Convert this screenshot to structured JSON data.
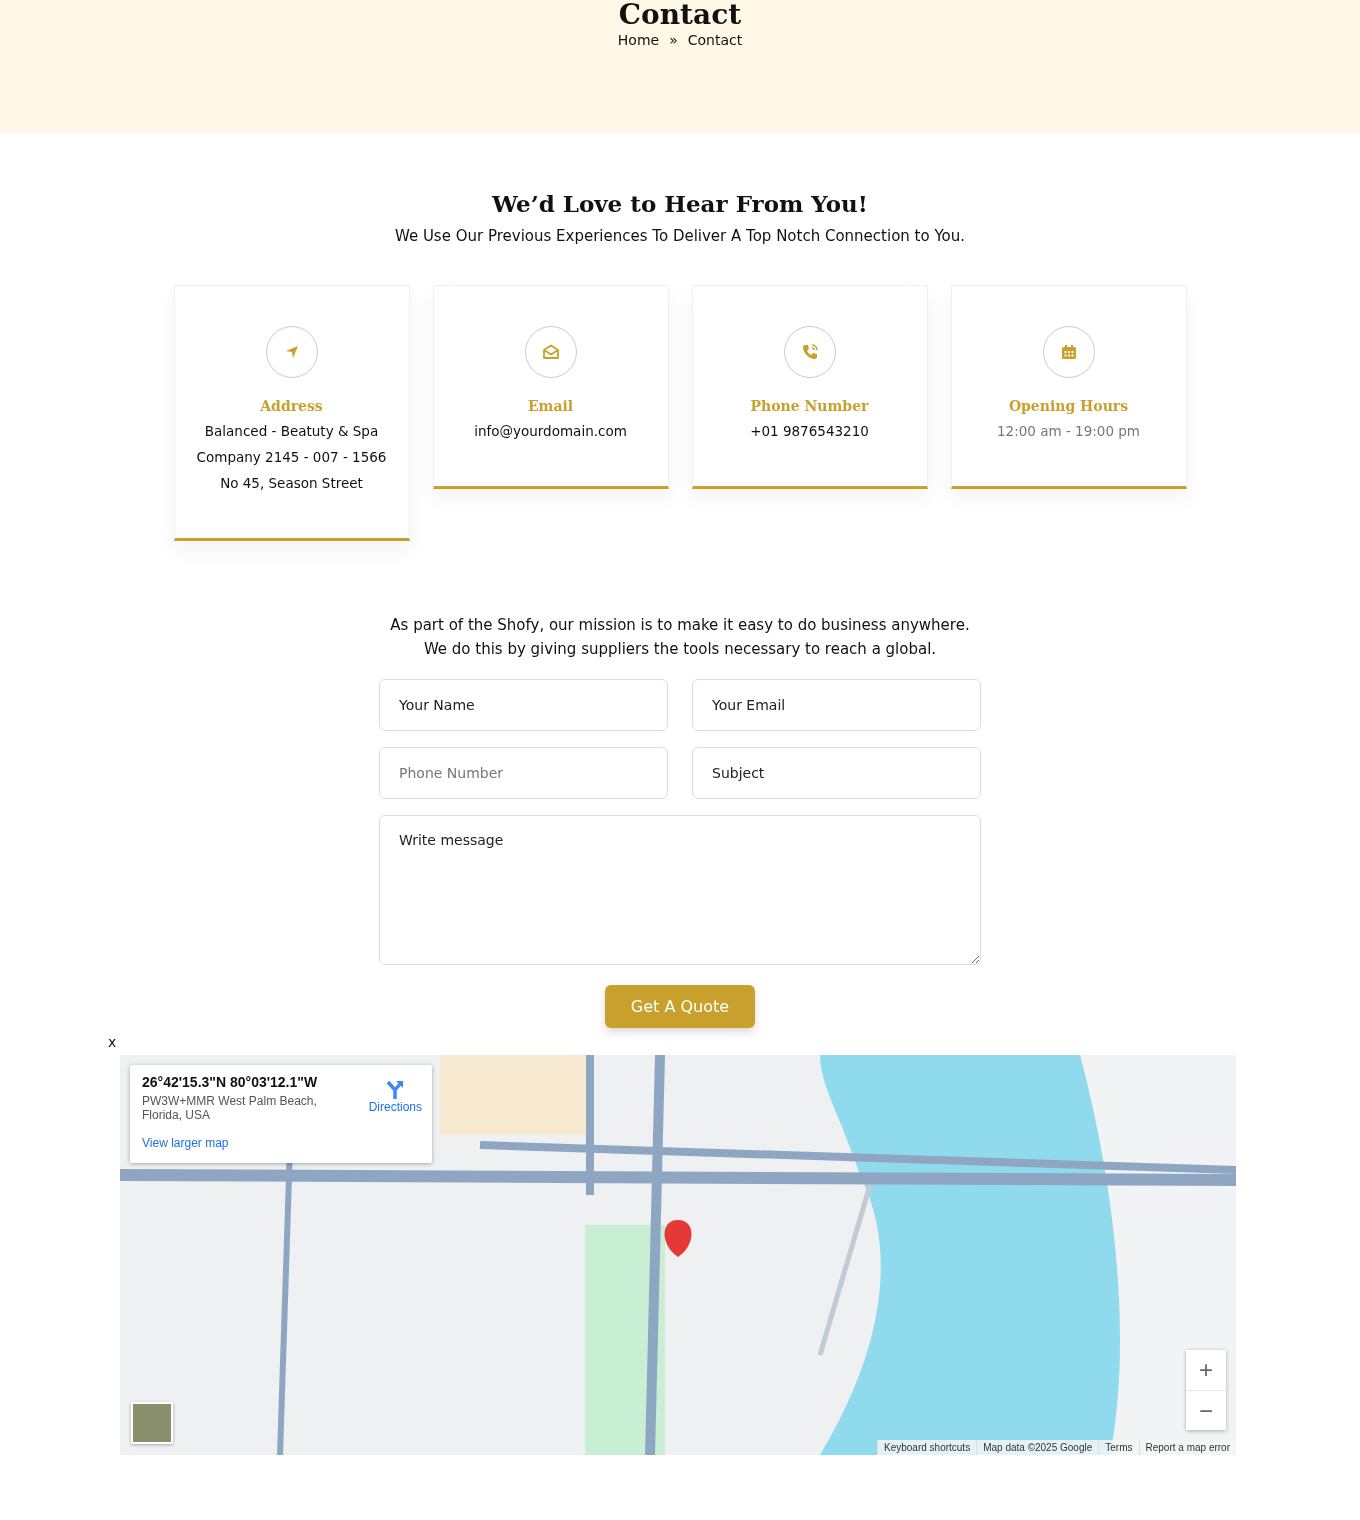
{
  "hero": {
    "title": "Contact",
    "breadcrumb": [
      "Home",
      "»",
      "Contact"
    ]
  },
  "intro": {
    "title": "We’d Love to Hear From You!",
    "subtitle": "We Use Our Previous Experiences To Deliver A Top Notch Connection to You."
  },
  "cards": [
    {
      "kind": "address",
      "title": "Address",
      "lines": [
        "Balanced - Beatuty & Spa",
        "Company 2145 - 007 - 1566",
        "No 45, Season Street"
      ],
      "muted": false
    },
    {
      "kind": "email",
      "title": "Email",
      "lines": [
        "info@yourdomain.com"
      ],
      "muted": false
    },
    {
      "kind": "phone",
      "title": "Phone Number",
      "lines": [
        "+01 9876543210"
      ],
      "muted": false
    },
    {
      "kind": "hours",
      "title": "Opening Hours",
      "lines": [
        "12:00 am - 19:00 pm"
      ],
      "muted": true
    }
  ],
  "mission": "As part of the Shofy, our mission is to make it easy to do business anywhere.\nWe do this by giving suppliers the tools necessary to reach a global.",
  "form": {
    "fields": [
      {
        "kind": "text",
        "placeholder": "Your Name"
      },
      {
        "kind": "email",
        "placeholder": "Your Email"
      },
      {
        "kind": "tel",
        "placeholder": "Phone Number"
      },
      {
        "kind": "text",
        "placeholder": "Subject"
      },
      {
        "kind": "textarea",
        "placeholder": "Write message"
      }
    ],
    "submit": "Get A Quote"
  },
  "map": {
    "close": "x",
    "place": {
      "coords": "26°42'15.3\"N 80°03'12.1\"W",
      "address": "PW3W+MMR West Palm Beach, Florida, USA",
      "directions": "Directions",
      "larger_map": "View larger map"
    },
    "zoom": [
      "+",
      "−"
    ],
    "attribution": [
      "Keyboard shortcuts",
      "Map data ©2025 Google",
      "Terms",
      "Report a map error"
    ]
  }
}
